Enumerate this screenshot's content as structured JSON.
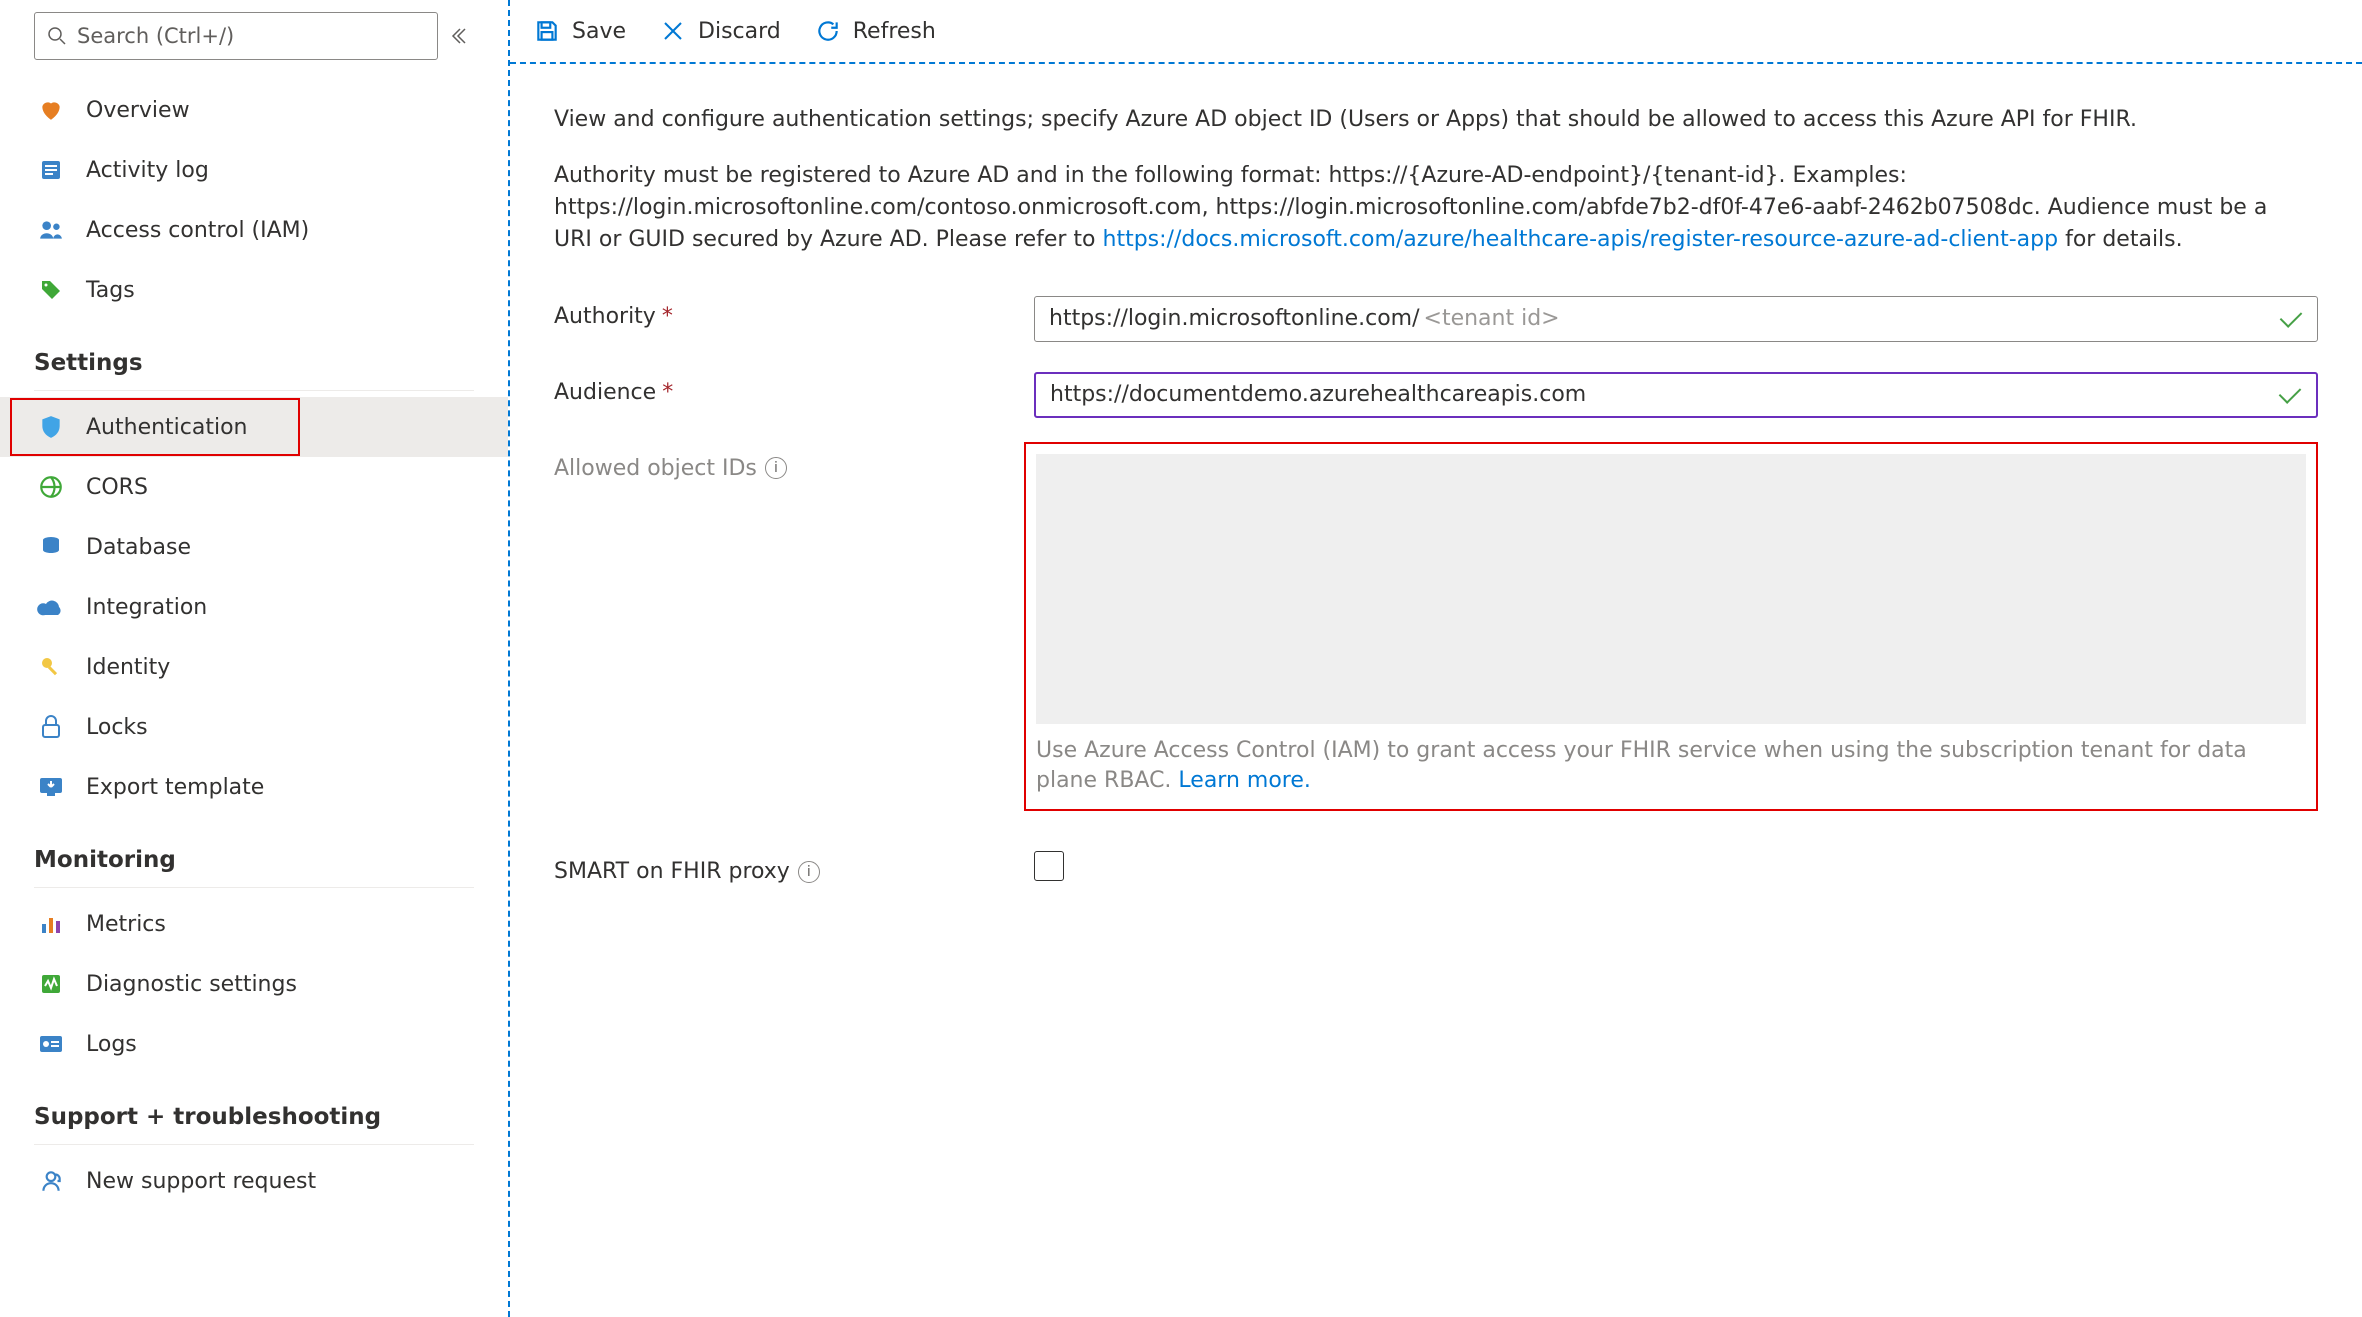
{
  "search": {
    "placeholder": "Search (Ctrl+/)"
  },
  "nav_top": [
    {
      "key": "overview",
      "label": "Overview"
    },
    {
      "key": "activity",
      "label": "Activity log"
    },
    {
      "key": "iam",
      "label": "Access control (IAM)"
    },
    {
      "key": "tags",
      "label": "Tags"
    }
  ],
  "sections": {
    "settings": {
      "title": "Settings",
      "items": [
        {
          "key": "authentication",
          "label": "Authentication",
          "selected": true
        },
        {
          "key": "cors",
          "label": "CORS"
        },
        {
          "key": "database",
          "label": "Database"
        },
        {
          "key": "integration",
          "label": "Integration"
        },
        {
          "key": "identity",
          "label": "Identity"
        },
        {
          "key": "locks",
          "label": "Locks"
        },
        {
          "key": "export",
          "label": "Export template"
        }
      ]
    },
    "monitoring": {
      "title": "Monitoring",
      "items": [
        {
          "key": "metrics",
          "label": "Metrics"
        },
        {
          "key": "diag",
          "label": "Diagnostic settings"
        },
        {
          "key": "logs",
          "label": "Logs"
        }
      ]
    },
    "support": {
      "title": "Support + troubleshooting",
      "items": [
        {
          "key": "support-req",
          "label": "New support request"
        }
      ]
    }
  },
  "toolbar": {
    "save": "Save",
    "discard": "Discard",
    "refresh": "Refresh"
  },
  "intro": "View and configure authentication settings; specify Azure AD object ID (Users or Apps) that should be allowed to access this Azure API for FHIR.",
  "para2_pre": "Authority must be registered to Azure AD and in the following format: https://{Azure-AD-endpoint}/{tenant-id}. Examples: https://login.microsoftonline.com/contoso.onmicrosoft.com, https://login.microsoftonline.com/abfde7b2-df0f-47e6-aabf-2462b07508dc. Audience must be a URI or GUID secured by Azure AD. Please refer to ",
  "para2_link_text": "https://docs.microsoft.com/azure/healthcare-apis/register-resource-azure-ad-client-app",
  "para2_post": " for details.",
  "form": {
    "authority_label": "Authority",
    "authority_value": "https://login.microsoftonline.com/",
    "authority_tenant_hint": "<tenant id>",
    "audience_label": "Audience",
    "audience_value": "https://documentdemo.azurehealthcareapis.com",
    "object_ids_label": "Allowed object IDs",
    "hint_pre": "Use Azure Access Control (IAM) to grant access your FHIR service when using the subscription tenant for data plane RBAC. ",
    "hint_link": "Learn more.",
    "smart_label": "SMART on FHIR proxy"
  }
}
